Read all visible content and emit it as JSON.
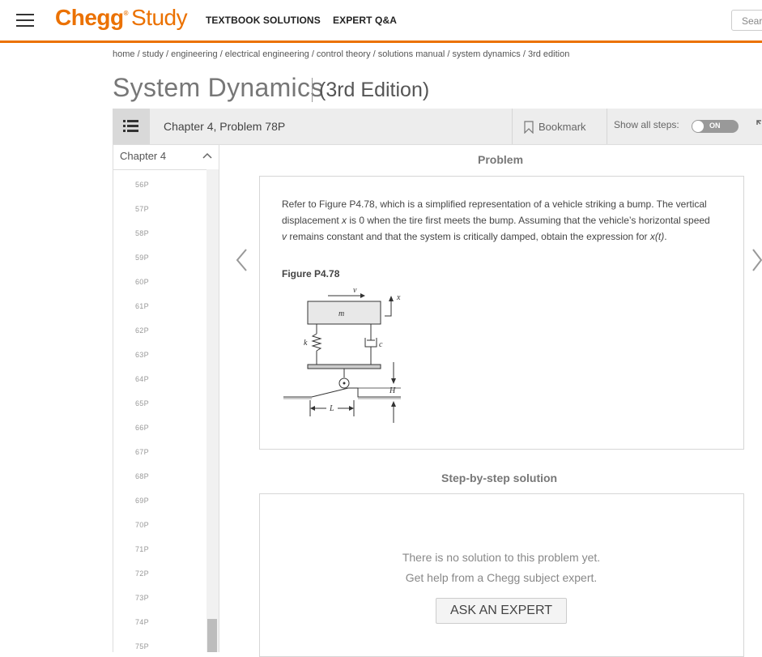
{
  "header": {
    "logo_chegg": "Chegg",
    "logo_study": "Study",
    "logo_reg": "®",
    "nav": [
      "TEXTBOOK SOLUTIONS",
      "EXPERT Q&A"
    ],
    "search_placeholder": "Sear",
    "accent_color": "#eb7100"
  },
  "breadcrumb": "home / study / engineering / electrical engineering / control theory / solutions manual / system dynamics / 3rd edition",
  "book": {
    "title": "System Dynamics",
    "edition": "(3rd Edition)"
  },
  "toolbar": {
    "title": "Chapter 4, Problem 78P",
    "bookmark_label": "Bookmark",
    "show_steps_label": "Show all steps:",
    "toggle_label": "ON"
  },
  "sidebar": {
    "chapter_label": "Chapter 4",
    "problems": [
      "56P",
      "57P",
      "58P",
      "59P",
      "60P",
      "61P",
      "62P",
      "63P",
      "64P",
      "65P",
      "66P",
      "67P",
      "68P",
      "69P",
      "70P",
      "71P",
      "72P",
      "73P",
      "74P",
      "75P"
    ]
  },
  "problem": {
    "heading": "Problem",
    "text_1": "Refer to Figure P4.78, which is a simplified representation of a vehicle striking a bump. The vertical displacement ",
    "x_var": "x",
    "text_2": " is 0 when the tire first meets the bump. Assuming that the vehicle’s horizontal speed ",
    "v_var": "v",
    "text_3": " remains constant and that the system is critically damped, obtain the expression for ",
    "xt_var": "x(t)",
    "text_4": ".",
    "figure_label": "Figure P4.78",
    "figure_labels": {
      "v": "v",
      "x": "x",
      "m": "m",
      "k": "k",
      "c": "c",
      "H": "H",
      "L": "L"
    }
  },
  "solution": {
    "heading": "Step-by-step solution",
    "line1": "There is no solution to this problem yet.",
    "line2": "Get help from a Chegg subject expert.",
    "ask_button": "ASK AN EXPERT"
  }
}
